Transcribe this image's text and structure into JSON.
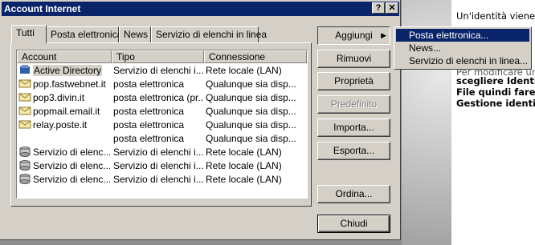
{
  "window": {
    "title": "Account Internet",
    "help_label": "?",
    "close_label": "✕"
  },
  "tabs": [
    {
      "label": "Tutti"
    },
    {
      "label": "Posta elettronica"
    },
    {
      "label": "News"
    },
    {
      "label": "Servizio di elenchi in linea"
    }
  ],
  "columns": {
    "account": "Account",
    "tipo": "Tipo",
    "connessione": "Connessione"
  },
  "rows": [
    {
      "icon": "directory-icon",
      "account": "Active Directory",
      "tipo": "Servizio di elenchi i...",
      "connessione": "Rete locale (LAN)"
    },
    {
      "icon": "mail-account-icon",
      "account": "pop.fastwebnet.it",
      "tipo": "posta elettronica",
      "connessione": "Qualunque sia disp..."
    },
    {
      "icon": "mail-account-icon",
      "account": "pop3.divin.it",
      "tipo": "posta elettronica (pr...",
      "connessione": "Qualunque sia disp..."
    },
    {
      "icon": "mail-account-icon",
      "account": "popmail.email.it",
      "tipo": "posta elettronica",
      "connessione": "Qualunque sia disp..."
    },
    {
      "icon": "mail-account-icon",
      "account": "relay.poste.it",
      "tipo": "posta elettronica",
      "connessione": "Qualunque sia disp..."
    },
    {
      "icon": "",
      "account": "",
      "tipo": "posta elettronica",
      "connessione": "Qualunque sia disp..."
    },
    {
      "icon": "directory-service-icon",
      "account": "Servizio di elenc...",
      "tipo": "Servizio di elenchi i...",
      "connessione": "Rete locale (LAN)"
    },
    {
      "icon": "directory-service-icon",
      "account": "Servizio di elenc...",
      "tipo": "Servizio di elenchi i...",
      "connessione": "Rete locale (LAN)"
    },
    {
      "icon": "directory-service-icon",
      "account": "Servizio di elenc...",
      "tipo": "Servizio di elenchi i...",
      "connessione": "Rete locale (LAN)"
    }
  ],
  "buttons": {
    "aggiungi": "Aggiungi",
    "rimuovi": "Rimuovi",
    "proprieta": "Proprietà",
    "predefinito": "Predefinito",
    "importa": "Importa...",
    "esporta": "Esporta...",
    "ordina": "Ordina...",
    "chiudi": "Chiudi"
  },
  "menu": [
    {
      "label": "Posta elettronica..."
    },
    {
      "label": "News..."
    },
    {
      "label": "Servizio di elenchi in linea..."
    }
  ],
  "background_text": [
    "Un'identità viene",
    "Per modificare un",
    "scegliere Identit",
    "File quindi fare c",
    "Gestione identi"
  ],
  "colors": {
    "titlebar": "#0a246a",
    "face": "#d4d0c8",
    "highlight": "#0a246a"
  }
}
